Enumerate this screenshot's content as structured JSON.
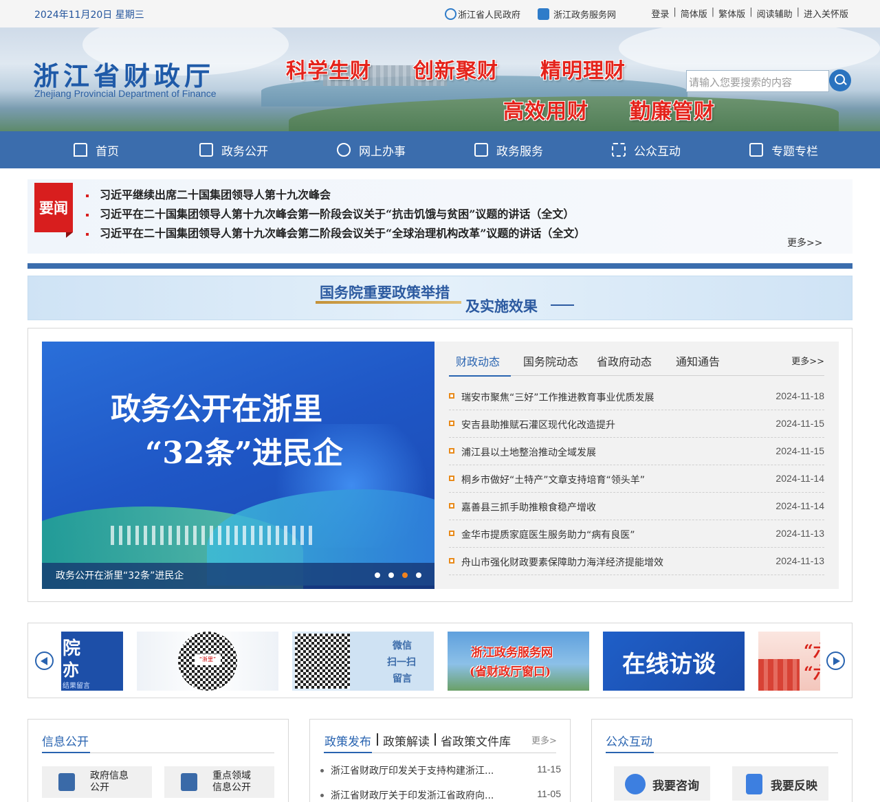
{
  "topbar": {
    "date": "2024年11月20日 星期三",
    "links": [
      "浙江省人民政府",
      "浙江政务服务网"
    ],
    "tools": [
      "登录",
      "简体版",
      "繁体版",
      "阅读辅助",
      "进入关怀版"
    ]
  },
  "header": {
    "logo_cn": "浙江省财政厅",
    "logo_en": "Zhejiang Provincial Department of Finance",
    "slogans": [
      "科学生财",
      "创新聚财",
      "精明理财",
      "高效用财",
      "勤廉管财"
    ],
    "search_placeholder": "请输入您要搜索的内容"
  },
  "nav": [
    "首页",
    "政务公开",
    "网上办事",
    "政务服务",
    "公众互动",
    "专题专栏"
  ],
  "headline": {
    "tag": "要闻",
    "items": [
      "习近平继续出席二十国集团领导人第十九次峰会",
      "习近平在二十国集团领导人第十九次峰会第一阶段会议关于“抗击饥饿与贫困”议题的讲话（全文）",
      "习近平在二十国集团领导人第十九次峰会第二阶段会议关于“全球治理机构改革”议题的讲话（全文）"
    ],
    "more": "更多>>"
  },
  "policy_banner": {
    "line1": "国务院重要政策举措",
    "line2": "及实施效果"
  },
  "slideshow": {
    "title_line1": "政务公开在浙里",
    "title_line2": "“32条”进民企",
    "caption": "政务公开在浙里“32条”进民企",
    "dots": 4,
    "active_dot": 3
  },
  "news_tabs": {
    "tabs": [
      "财政动态",
      "国务院动态",
      "省政府动态",
      "通知通告"
    ],
    "active": "财政动态",
    "more": "更多>>",
    "items": [
      {
        "title": "瑞安市聚焦“三好”工作推进教育事业优质发展",
        "date": "2024-11-18"
      },
      {
        "title": "安吉县助推赋石灌区现代化改造提升",
        "date": "2024-11-15"
      },
      {
        "title": "浦江县以土地整治推动全域发展",
        "date": "2024-11-15"
      },
      {
        "title": "桐乡市做好“土特产”文章支持培育“领头羊”",
        "date": "2024-11-14"
      },
      {
        "title": "嘉善县三抓手助推粮食稳产增收",
        "date": "2024-11-14"
      },
      {
        "title": "金华市提质家庭医生服务助力“病有良医”",
        "date": "2024-11-13"
      },
      {
        "title": "舟山市强化财政要素保障助力海洋经济提能增效",
        "date": "2024-11-13"
      }
    ]
  },
  "link_strip": {
    "cards": [
      {
        "text1": "院",
        "text2": "亦",
        "text3": "结果留言"
      },
      {
        "text1": "“浙里”"
      },
      {
        "text1": "微信",
        "text2": "扫一扫",
        "text3": "留言"
      },
      {
        "text1": "浙江政务服务网",
        "text2": "(省财政厅窗口)"
      },
      {
        "text1": "在线访谈"
      },
      {
        "text1": "“六",
        "text2": "“六"
      }
    ]
  },
  "info_open": {
    "heading": "信息公开",
    "buttons": [
      "政府信息\n公开",
      "重点领域\n信息公开"
    ]
  },
  "policy_section": {
    "tabs": [
      "政策发布",
      "政策解读",
      "省政策文件库"
    ],
    "more": "更多>",
    "items": [
      {
        "title": "浙江省财政厅印发关于支持构建浙江...",
        "date": "11-15"
      },
      {
        "title": "浙江省财政厅关于印发浙江省政府向...",
        "date": "11-05"
      }
    ]
  },
  "interaction": {
    "heading": "公众互动",
    "buttons": [
      "我要咨询",
      "我要反映"
    ]
  },
  "colors": {
    "brand_blue": "#3b6dad",
    "accent_red": "#d81e1e",
    "link_blue": "#2863b0",
    "bullet_orange": "#e88a1a"
  }
}
